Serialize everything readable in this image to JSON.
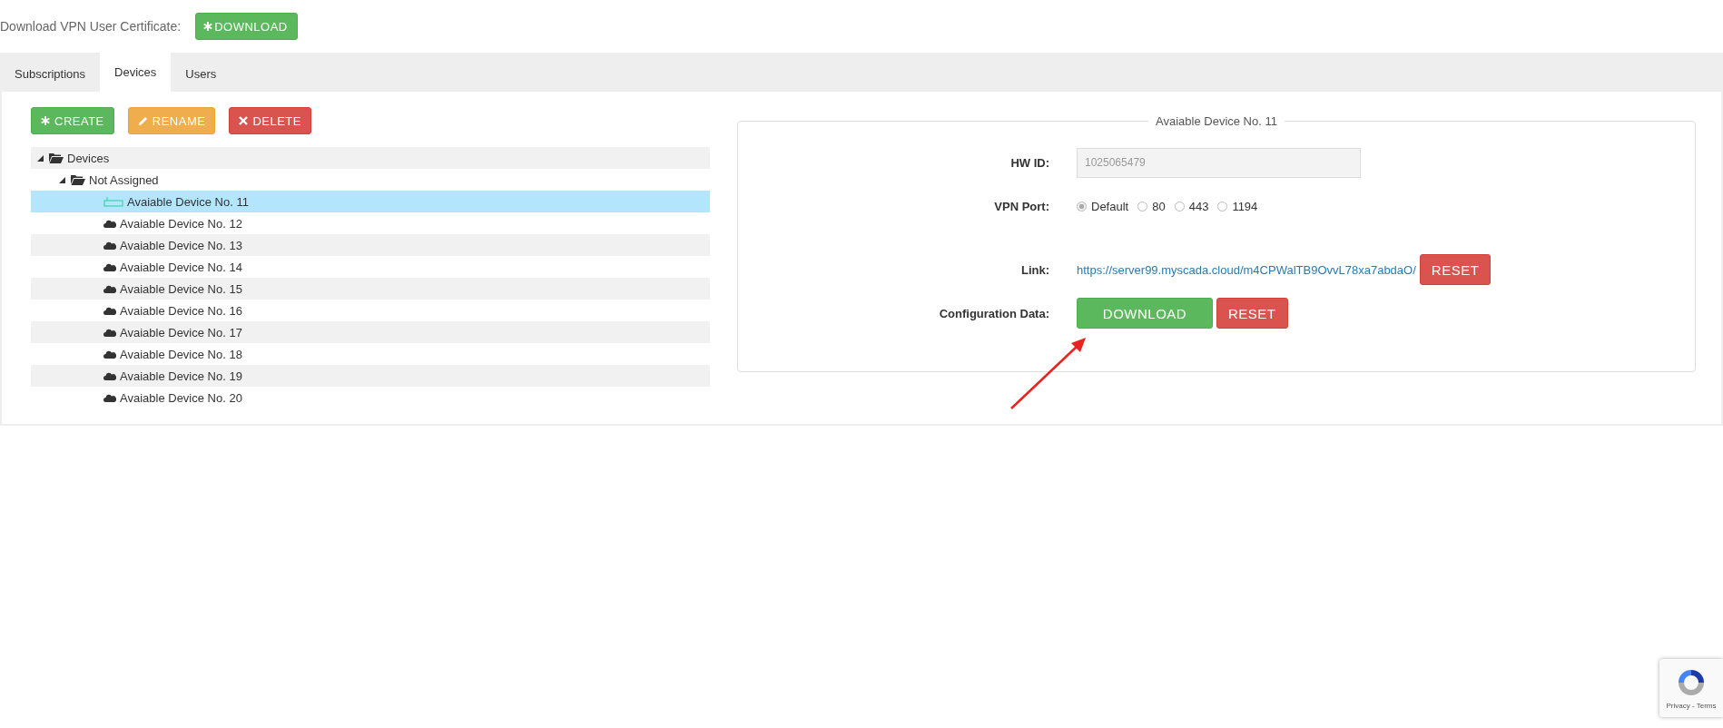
{
  "certificate": {
    "label": "Download VPN User Certificate:",
    "button": "DOWNLOAD"
  },
  "tabs": [
    {
      "label": "Subscriptions",
      "selected": false
    },
    {
      "label": "Devices",
      "selected": true
    },
    {
      "label": "Users",
      "selected": false
    }
  ],
  "toolbar": [
    {
      "label": "CREATE",
      "kind": "create"
    },
    {
      "label": "RENAME",
      "kind": "rename"
    },
    {
      "label": "DELETE",
      "kind": "delete"
    }
  ],
  "tree": [
    {
      "label": "Devices",
      "kind": "folder",
      "expanded": true,
      "selected": false,
      "children": [
        {
          "label": "Not Assigned",
          "kind": "folder",
          "expanded": true,
          "selected": false,
          "children": [
            {
              "label": "Avaiable Device No. 11",
              "kind": "router",
              "selected": true
            },
            {
              "label": "Avaiable Device No. 12",
              "kind": "cloud",
              "selected": false
            },
            {
              "label": "Avaiable Device No. 13",
              "kind": "cloud",
              "selected": false
            },
            {
              "label": "Avaiable Device No. 14",
              "kind": "cloud",
              "selected": false
            },
            {
              "label": "Avaiable Device No. 15",
              "kind": "cloud",
              "selected": false
            },
            {
              "label": "Avaiable Device No. 16",
              "kind": "cloud",
              "selected": false
            },
            {
              "label": "Avaiable Device No. 17",
              "kind": "cloud",
              "selected": false
            },
            {
              "label": "Avaiable Device No. 18",
              "kind": "cloud",
              "selected": false
            },
            {
              "label": "Avaiable Device No. 19",
              "kind": "cloud",
              "selected": false
            },
            {
              "label": "Avaiable Device No. 20",
              "kind": "cloud",
              "selected": false
            }
          ]
        }
      ]
    }
  ],
  "details": {
    "legend": "Avaiable Device No. 11",
    "hw_id": {
      "label": "HW ID:",
      "value": "1025065479"
    },
    "vpn_port": {
      "label": "VPN Port:",
      "options": [
        {
          "label": "Default",
          "selected": true
        },
        {
          "label": "80",
          "selected": false
        },
        {
          "label": "443",
          "selected": false
        },
        {
          "label": "1194",
          "selected": false
        }
      ]
    },
    "link": {
      "label": "Link:",
      "url": "https://server99.myscada.cloud/m4CPWalTB9OvvL78xa7abdaO/",
      "reset": "RESET"
    },
    "configuration": {
      "label": "Configuration Data:",
      "download": "DOWNLOAD",
      "reset": "RESET"
    }
  },
  "recaptcha": {
    "text": "Privacy - Terms"
  }
}
